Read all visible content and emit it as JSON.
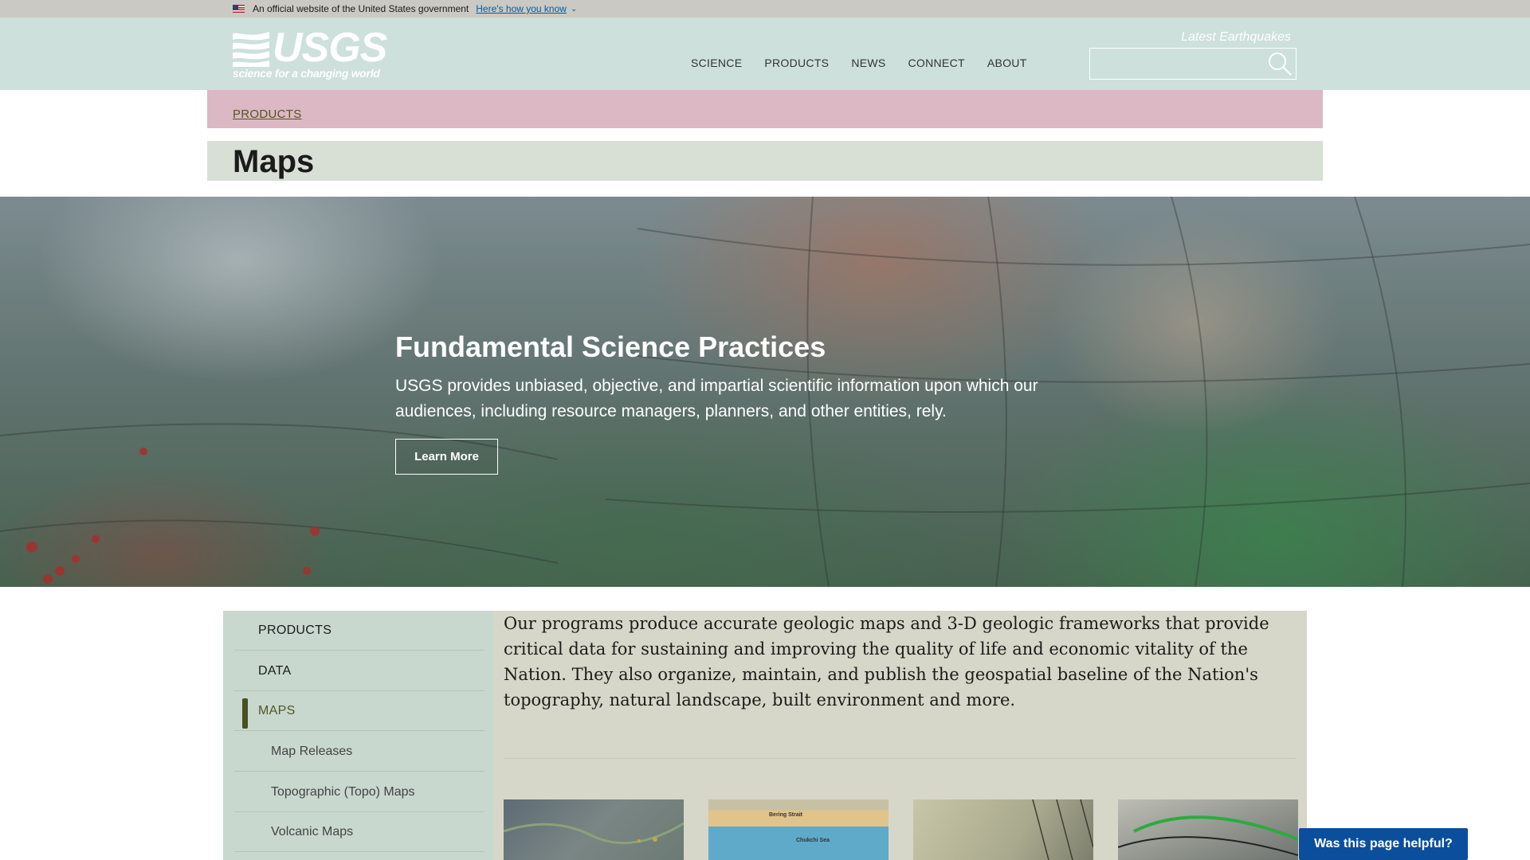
{
  "gov_banner": {
    "text": "An official website of the United States government",
    "link": "Here's how you know"
  },
  "header": {
    "logo_word": "USGS",
    "logo_tagline": "science for a changing world",
    "latest_earthquakes": "Latest Earthquakes",
    "nav": [
      "SCIENCE",
      "PRODUCTS",
      "NEWS",
      "CONNECT",
      "ABOUT"
    ],
    "search_placeholder": ""
  },
  "breadcrumb": "PRODUCTS",
  "page_title": "Maps",
  "hero": {
    "title": "Fundamental Science Practices",
    "text": "USGS provides unbiased, objective, and impartial scientific information upon which our audiences, including resource managers, planners, and other entities, rely.",
    "button": "Learn More"
  },
  "sidebar": {
    "items": [
      {
        "label": "PRODUCTS",
        "level": "top"
      },
      {
        "label": "DATA",
        "level": "top"
      },
      {
        "label": "MAPS",
        "level": "top",
        "active": true
      },
      {
        "label": "Map Releases",
        "level": "sub"
      },
      {
        "label": "Topographic (Topo) Maps",
        "level": "sub"
      },
      {
        "label": "Volcanic Maps",
        "level": "sub"
      }
    ]
  },
  "main": {
    "intro": "Our programs produce accurate geologic maps and 3-D geologic frameworks that provide critical data for sustaining and improving the quality of life and economic vitality of the Nation. They also organize, maintain, and publish the geospatial baseline of the Nation's topography, natural landscape, built environment and more.",
    "thumb2_labels": [
      "Bering Strait",
      "Chukchi Sea"
    ]
  },
  "feedback_button": "Was this page helpful?",
  "colors": {
    "header_bg": "#cde0dc",
    "breadcrumb_bg": "#dbb8c3",
    "title_bg": "#d8e0d6",
    "feedback_bg": "#0b4f9c"
  }
}
